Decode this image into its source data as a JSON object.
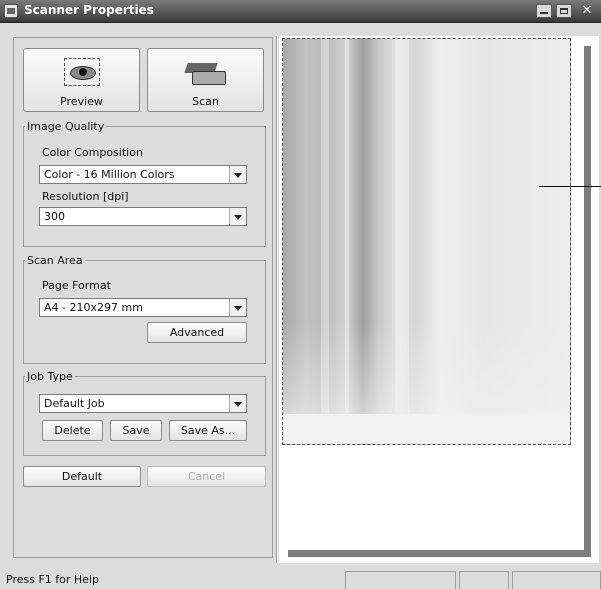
{
  "window": {
    "title": "Scanner Properties"
  },
  "toolbar": {
    "preview_label": "Preview",
    "scan_label": "Scan"
  },
  "image_quality": {
    "legend": "Image Quality",
    "color_label": "Color Composition",
    "color_value": "Color - 16 Million Colors",
    "resolution_label": "Resolution [dpi]",
    "resolution_value": "300"
  },
  "scan_area": {
    "legend": "Scan Area",
    "format_label": "Page Format",
    "format_value": "A4 - 210x297 mm",
    "advanced_label": "Advanced"
  },
  "job_type": {
    "legend": "Job Type",
    "job_value": "Default Job",
    "delete_label": "Delete",
    "save_label": "Save",
    "save_as_label": "Save As..."
  },
  "footer_buttons": {
    "default_label": "Default",
    "cancel_label": "Cancel"
  },
  "status": {
    "text": "Press F1 for Help"
  },
  "icons": [
    "window-icon",
    "minimize-icon",
    "maximize-icon",
    "close-icon",
    "preview-eye-icon",
    "scanner-icon",
    "dropdown-arrow-icon"
  ]
}
